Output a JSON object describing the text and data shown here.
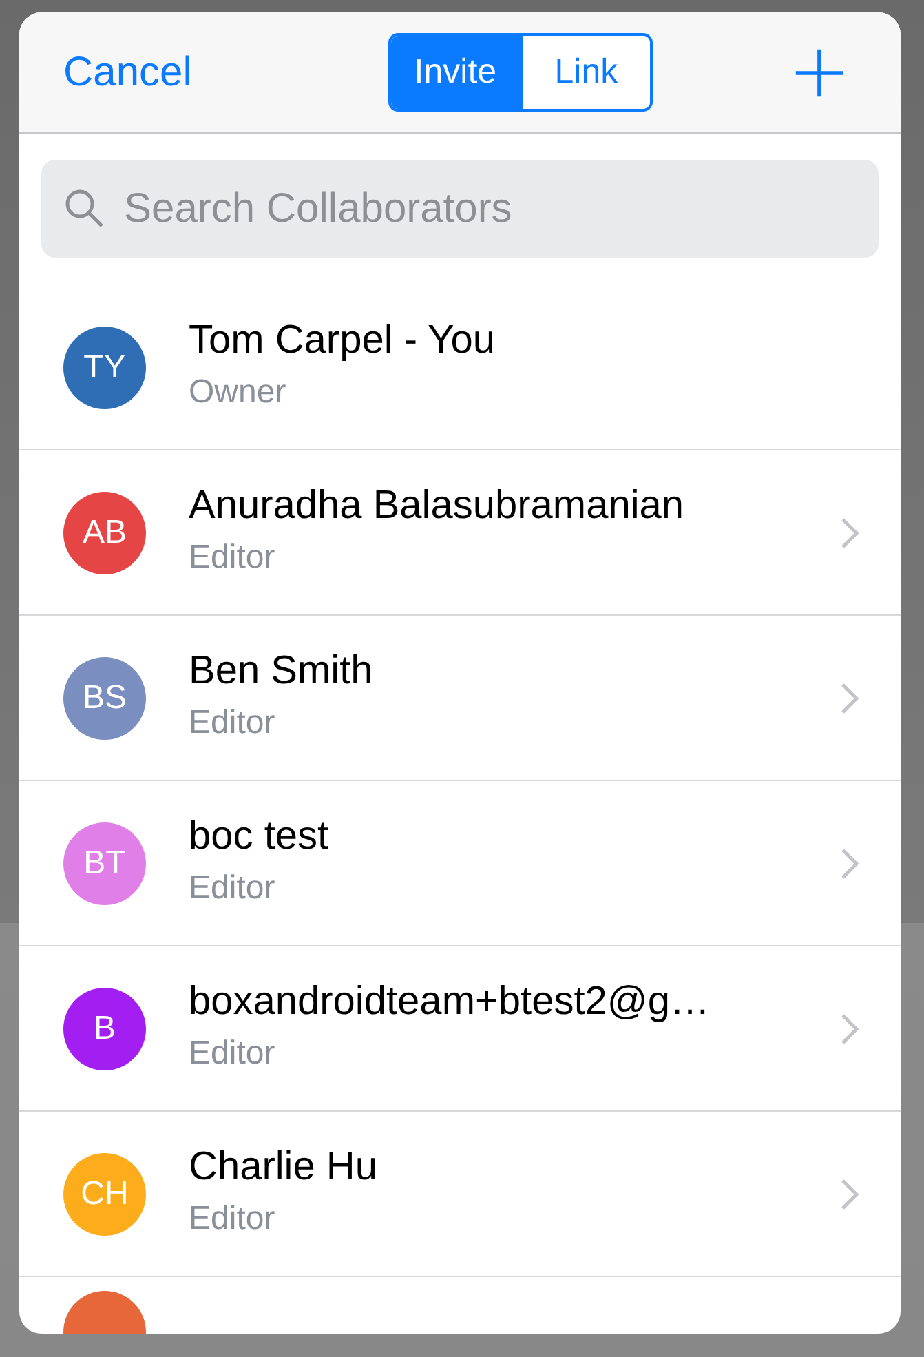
{
  "header": {
    "cancel": "Cancel",
    "segments": [
      {
        "label": "Invite",
        "selected": true
      },
      {
        "label": "Link",
        "selected": false
      }
    ]
  },
  "search": {
    "placeholder": "Search Collaborators"
  },
  "collaborators": [
    {
      "initials": "TY",
      "name": "Tom Carpel - You",
      "role": "Owner",
      "color": "#2f6db5",
      "has_chevron": false
    },
    {
      "initials": "AB",
      "name": "Anuradha Balasubramanian",
      "role": "Editor",
      "color": "#e64545",
      "has_chevron": true
    },
    {
      "initials": "BS",
      "name": "Ben Smith",
      "role": "Editor",
      "color": "#7a8fbf",
      "has_chevron": true
    },
    {
      "initials": "BT",
      "name": "boc test",
      "role": "Editor",
      "color": "#e07fe8",
      "has_chevron": true
    },
    {
      "initials": "B",
      "name": "boxandroidteam+btest2@g…",
      "role": "Editor",
      "color": "#a31ef0",
      "has_chevron": true
    },
    {
      "initials": "CH",
      "name": "Charlie Hu",
      "role": "Editor",
      "color": "#fdac1c",
      "has_chevron": true
    }
  ],
  "partial_row": {
    "color": "#e5673a"
  }
}
